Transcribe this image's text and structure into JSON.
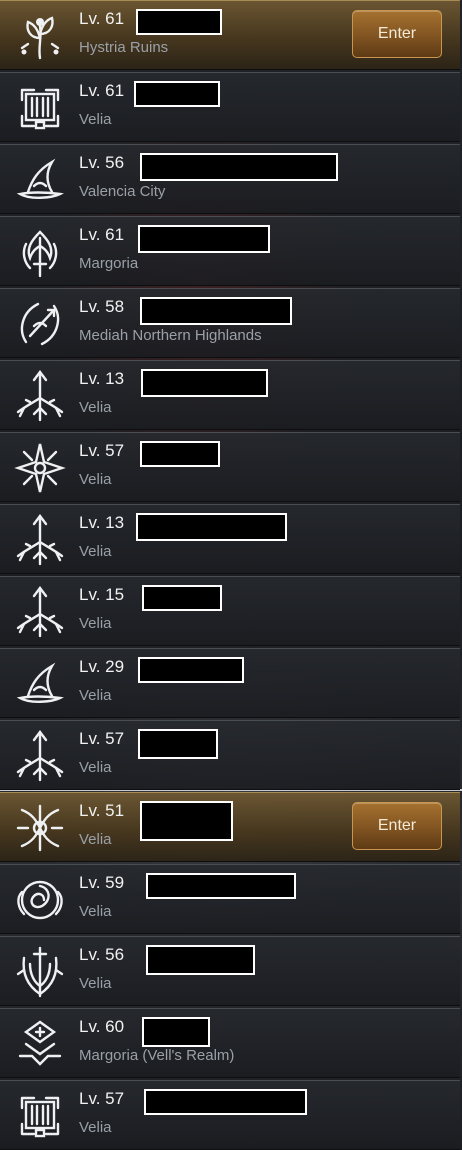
{
  "servers": [
    {
      "level": "Lv. 61",
      "location": "Hystria Ruins",
      "icon": "flower-icon",
      "active": true,
      "enter_label": "Enter"
    },
    {
      "level": "Lv. 61",
      "location": "Velia",
      "icon": "fortress-icon"
    },
    {
      "level": "Lv. 56",
      "location": "Valencia City",
      "icon": "witch-hat-icon"
    },
    {
      "level": "Lv. 61",
      "location": "Margoria",
      "icon": "flame-sword-icon"
    },
    {
      "level": "Lv. 58",
      "location": "Mediah Northern Highlands",
      "icon": "ranger-bow-icon"
    },
    {
      "level": "Lv. 13",
      "location": "Velia",
      "icon": "arrow-crest-icon"
    },
    {
      "level": "Lv. 57",
      "location": "Velia",
      "icon": "star-crest-icon"
    },
    {
      "level": "Lv. 13",
      "location": "Velia",
      "icon": "arrow-crest-icon"
    },
    {
      "level": "Lv. 15",
      "location": "Velia",
      "icon": "arrow-crest-icon"
    },
    {
      "level": "Lv. 29",
      "location": "Velia",
      "icon": "witch-hat-icon"
    },
    {
      "level": "Lv. 57",
      "location": "Velia",
      "icon": "arrow-crest-icon"
    },
    {
      "level": "Lv. 51",
      "location": "Velia",
      "icon": "mystic-crest-icon",
      "active": true,
      "enter_label": "Enter"
    },
    {
      "level": "Lv. 59",
      "location": "Velia",
      "icon": "rose-crest-icon"
    },
    {
      "level": "Lv. 56",
      "location": "Velia",
      "icon": "shield-sword-icon"
    },
    {
      "level": "Lv. 60",
      "location": "Margoria (Vell's Realm)",
      "icon": "rune-crest-icon"
    },
    {
      "level": "Lv. 57",
      "location": "Velia",
      "icon": "fortress-icon"
    }
  ]
}
